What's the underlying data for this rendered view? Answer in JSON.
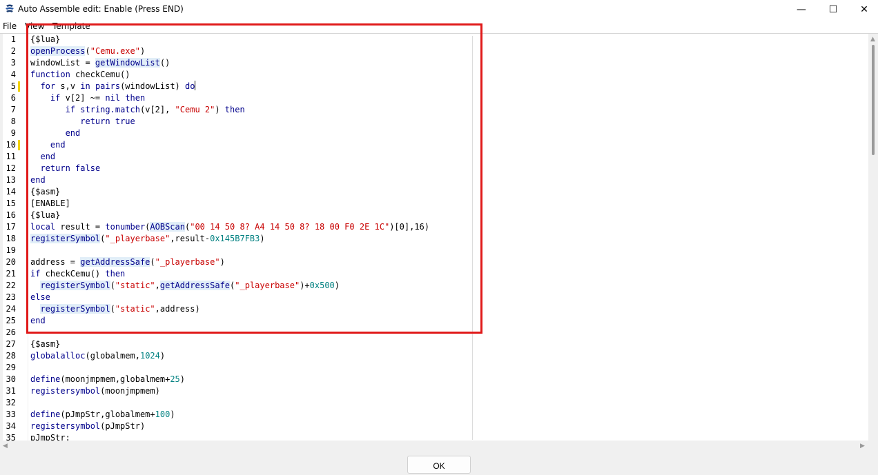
{
  "window": {
    "title": "Auto Assemble edit: Enable (Press END)",
    "minimize_glyph": "—",
    "maximize_glyph": "☐",
    "close_glyph": "✕"
  },
  "menu": [
    "File",
    "View",
    "Template"
  ],
  "icons": {
    "app": "cheat-engine-icon",
    "scroll_left": "arrow-left-icon",
    "scroll_right": "arrow-right-icon",
    "scroll_up": "arrow-up-icon"
  },
  "gutter_marks": [
    5,
    10
  ],
  "annotation": {
    "color": "#e01919"
  },
  "colors": {
    "keyword": "#00008b",
    "string": "#c80000",
    "number": "#008080",
    "highlight": "#e1eef8",
    "gutter_mark": "#f2d200"
  },
  "code_lines": [
    [
      [
        "{$lua}",
        ""
      ]
    ],
    [
      [
        "openProcess",
        "hlfn"
      ],
      [
        "(",
        ""
      ],
      [
        "\"Cemu.exe\"",
        "str"
      ],
      [
        ")",
        ""
      ]
    ],
    [
      [
        "windowList = ",
        ""
      ],
      [
        "getWindowList",
        "hlfn"
      ],
      [
        "()",
        ""
      ]
    ],
    [
      [
        "function",
        "kw"
      ],
      [
        " checkCemu()",
        ""
      ]
    ],
    [
      [
        "  ",
        ""
      ],
      [
        "for",
        "kw"
      ],
      [
        " s,v ",
        ""
      ],
      [
        "in",
        "kw"
      ],
      [
        " ",
        ""
      ],
      [
        "pairs",
        "fn"
      ],
      [
        "(windowList) ",
        ""
      ],
      [
        "do",
        "kw"
      ],
      [
        "|",
        "cursor"
      ]
    ],
    [
      [
        "    ",
        ""
      ],
      [
        "if",
        "kw"
      ],
      [
        " v[2] ~= ",
        ""
      ],
      [
        "nil",
        "kw"
      ],
      [
        " ",
        ""
      ],
      [
        "then",
        "kw"
      ]
    ],
    [
      [
        "       ",
        ""
      ],
      [
        "if",
        "kw"
      ],
      [
        " ",
        ""
      ],
      [
        "string.match",
        "fn"
      ],
      [
        "(v[2], ",
        ""
      ],
      [
        "\"Cemu 2\"",
        "str"
      ],
      [
        ") ",
        ""
      ],
      [
        "then",
        "kw"
      ]
    ],
    [
      [
        "          ",
        ""
      ],
      [
        "return",
        "kw"
      ],
      [
        " ",
        ""
      ],
      [
        "true",
        "kw"
      ]
    ],
    [
      [
        "       ",
        ""
      ],
      [
        "end",
        "kw"
      ]
    ],
    [
      [
        "    ",
        ""
      ],
      [
        "end",
        "kw"
      ]
    ],
    [
      [
        "  ",
        ""
      ],
      [
        "end",
        "kw"
      ]
    ],
    [
      [
        "  ",
        ""
      ],
      [
        "return",
        "kw"
      ],
      [
        " ",
        ""
      ],
      [
        "false",
        "kw"
      ]
    ],
    [
      [
        "end",
        "kw"
      ]
    ],
    [
      [
        "{$asm}",
        ""
      ]
    ],
    [
      [
        "[ENABLE]",
        ""
      ]
    ],
    [
      [
        "{$lua}",
        ""
      ]
    ],
    [
      [
        "local",
        "kw"
      ],
      [
        " result = ",
        ""
      ],
      [
        "tonumber",
        "fn"
      ],
      [
        "(",
        ""
      ],
      [
        "AOBScan",
        "hlfn"
      ],
      [
        "(",
        ""
      ],
      [
        "\"00 14 50 8? A4 14 50 8? 18 00 F0 2E 1C\"",
        "str"
      ],
      [
        ")[0],16)",
        ""
      ]
    ],
    [
      [
        "registerSymbol",
        "hlfn"
      ],
      [
        "(",
        ""
      ],
      [
        "\"_playerbase\"",
        "str"
      ],
      [
        ",result-",
        ""
      ],
      [
        "0x145B7FB3",
        "num"
      ],
      [
        ")",
        ""
      ]
    ],
    [
      [
        "",
        ""
      ]
    ],
    [
      [
        "address = ",
        ""
      ],
      [
        "getAddressSafe",
        "hlfn"
      ],
      [
        "(",
        ""
      ],
      [
        "\"_playerbase\"",
        "str"
      ],
      [
        ")",
        ""
      ]
    ],
    [
      [
        "if",
        "kw"
      ],
      [
        " checkCemu() ",
        ""
      ],
      [
        "then",
        "kw"
      ]
    ],
    [
      [
        "  ",
        ""
      ],
      [
        "registerSymbol",
        "hlfn"
      ],
      [
        "(",
        ""
      ],
      [
        "\"static\"",
        "str"
      ],
      [
        ",",
        ""
      ],
      [
        "getAddressSafe",
        "hlfn"
      ],
      [
        "(",
        ""
      ],
      [
        "\"_playerbase\"",
        "str"
      ],
      [
        ")+",
        ""
      ],
      [
        "0x500",
        "num"
      ],
      [
        ")",
        ""
      ]
    ],
    [
      [
        "else",
        "kw"
      ]
    ],
    [
      [
        "  ",
        ""
      ],
      [
        "registerSymbol",
        "hlfn"
      ],
      [
        "(",
        ""
      ],
      [
        "\"static\"",
        "str"
      ],
      [
        ",address)",
        ""
      ]
    ],
    [
      [
        "end",
        "kw"
      ]
    ],
    [
      [
        "",
        ""
      ]
    ],
    [
      [
        "{$asm}",
        ""
      ]
    ],
    [
      [
        "globalalloc",
        "kw"
      ],
      [
        "(globalmem,",
        ""
      ],
      [
        "1024",
        "num"
      ],
      [
        ")",
        ""
      ]
    ],
    [
      [
        "",
        ""
      ]
    ],
    [
      [
        "define",
        "kw"
      ],
      [
        "(moonjmpmem,globalmem+",
        ""
      ],
      [
        "25",
        "num"
      ],
      [
        ")",
        ""
      ]
    ],
    [
      [
        "registersymbol",
        "kw"
      ],
      [
        "(moonjmpmem)",
        ""
      ]
    ],
    [
      [
        "",
        ""
      ]
    ],
    [
      [
        "define",
        "kw"
      ],
      [
        "(pJmpStr,globalmem+",
        ""
      ],
      [
        "100",
        "num"
      ],
      [
        ")",
        ""
      ]
    ],
    [
      [
        "registersymbol",
        "kw"
      ],
      [
        "(pJmpStr)",
        ""
      ]
    ],
    [
      [
        "pJmpStr:",
        ""
      ]
    ]
  ],
  "buttons": {
    "ok": "OK"
  }
}
